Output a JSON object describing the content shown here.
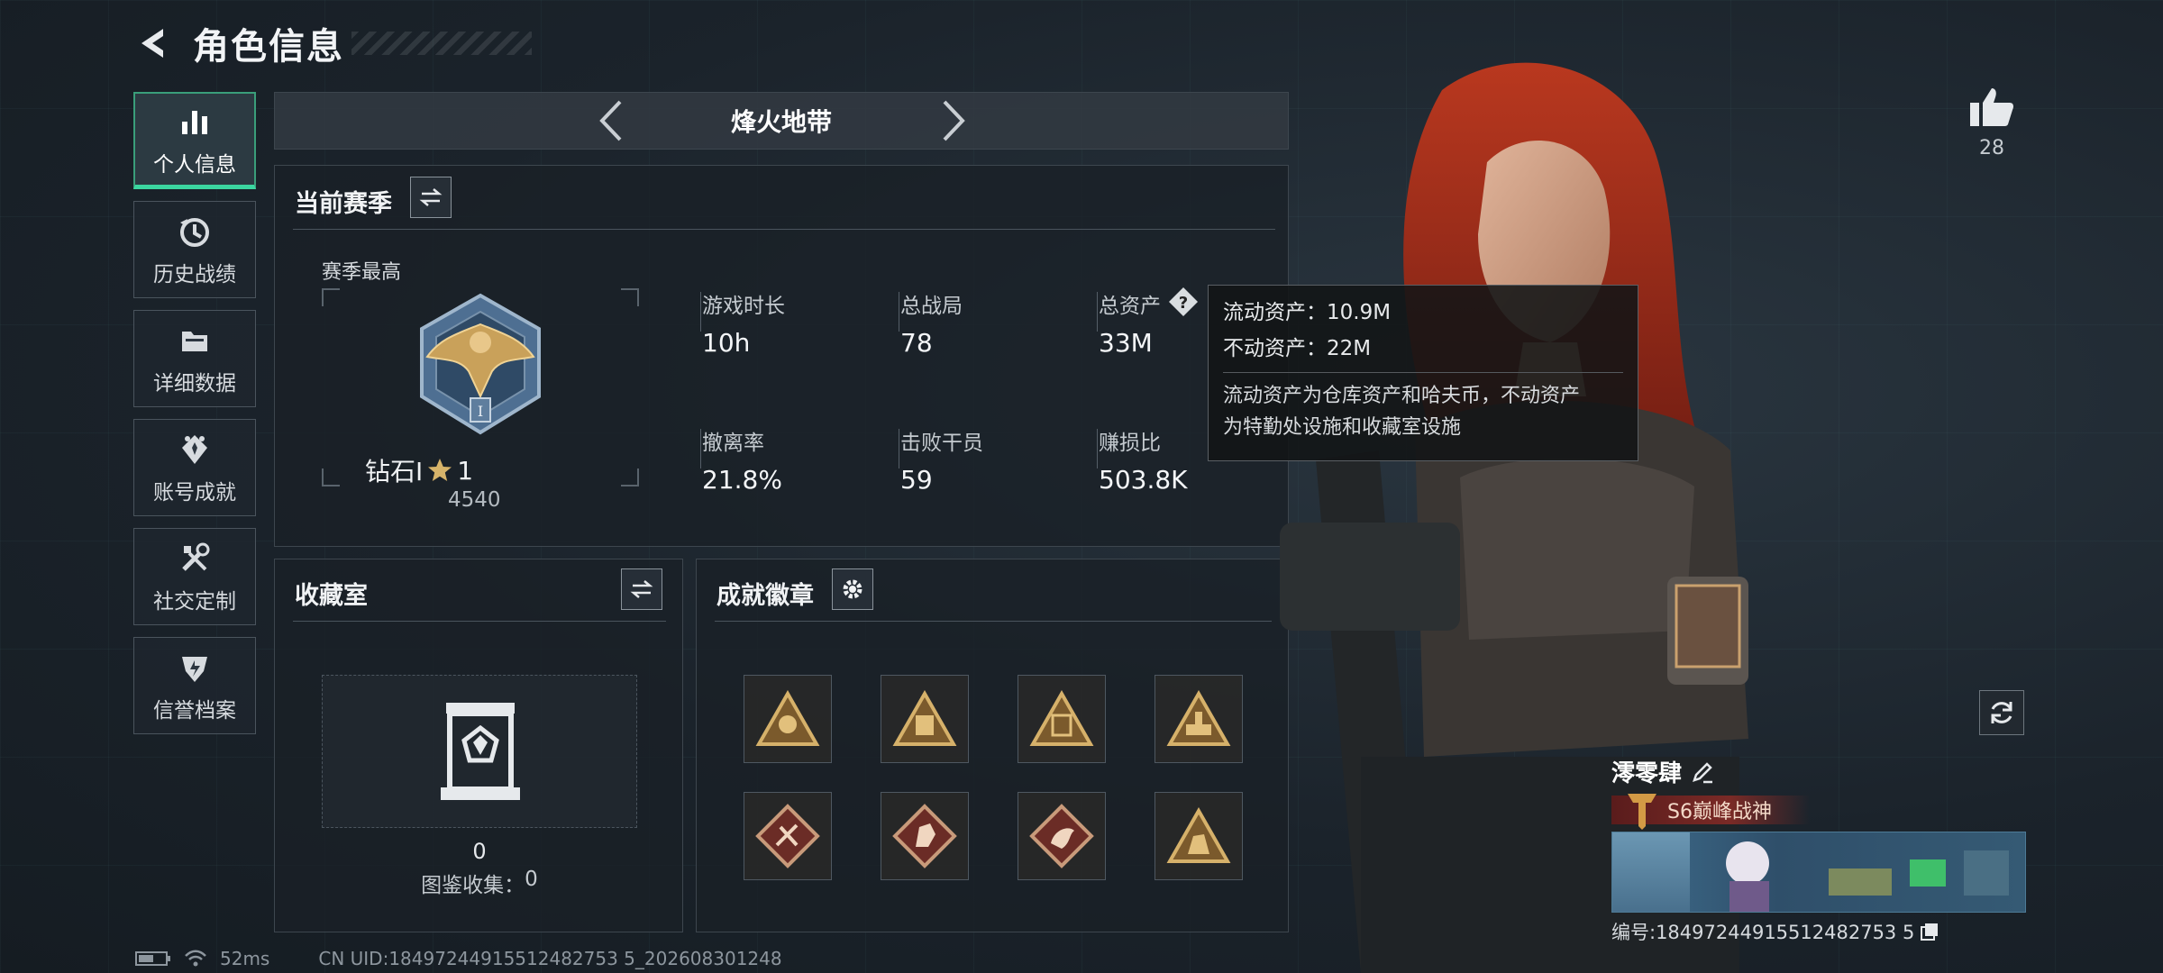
{
  "header": {
    "title": "角色信息"
  },
  "sidebar": {
    "items": [
      {
        "label": "个人信息",
        "icon": "bar-chart-icon",
        "active": true
      },
      {
        "label": "历史战绩",
        "icon": "history-clock-icon",
        "active": false
      },
      {
        "label": "详细数据",
        "icon": "folder-icon",
        "active": false
      },
      {
        "label": "账号成就",
        "icon": "achievement-icon",
        "active": false
      },
      {
        "label": "社交定制",
        "icon": "wrench-tools-icon",
        "active": false
      },
      {
        "label": "信誉档案",
        "icon": "credit-shield-icon",
        "active": false
      }
    ]
  },
  "mode": {
    "label": "烽火地带"
  },
  "season": {
    "title": "当前赛季",
    "best_label": "赛季最高",
    "rank_name": "钻石Ⅰ",
    "rank_stars": "1",
    "rank_score": "4540",
    "stats": [
      {
        "label": "游戏时长",
        "value": "10h"
      },
      {
        "label": "总战局",
        "value": "78"
      },
      {
        "label": "总资产",
        "value": "33M"
      },
      {
        "label": "撤离率",
        "value": "21.8%"
      },
      {
        "label": "击败干员",
        "value": "59"
      },
      {
        "label": "赚损比",
        "value": "503.8K"
      }
    ]
  },
  "tooltip": {
    "liquid": "流动资产：10.9M",
    "fixed": "不动资产：22M",
    "desc_line1": "流动资产为仓库资产和哈夫币，不动资产",
    "desc_line2": "为特勤处设施和收藏室设施"
  },
  "collection": {
    "title": "收藏室",
    "count": "0",
    "caption_label": "图鉴收集：",
    "caption_value": "0"
  },
  "achievements": {
    "title": "成就徽章"
  },
  "like": {
    "count": "28"
  },
  "player": {
    "name": "澪零肆",
    "title": "S6巅峰战神",
    "id_text": "编号:18497244915512482753 5"
  },
  "status": {
    "ping": "52ms",
    "uid": "CN UID:18497244915512482753 5_202608301248"
  },
  "colors": {
    "accent": "#3bd6a0",
    "gold": "#c9a15a",
    "title_red": "#7a2a26"
  }
}
